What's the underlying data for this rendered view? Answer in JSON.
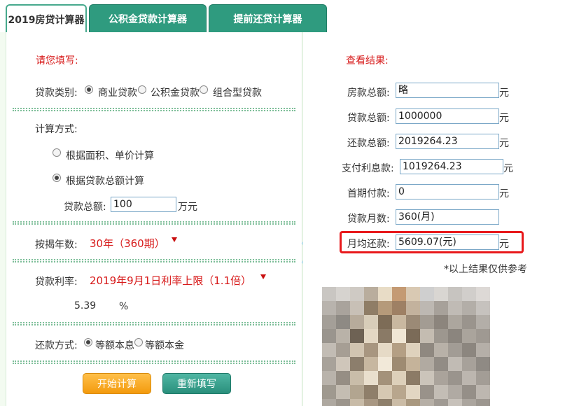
{
  "tabs": [
    {
      "label": "2019房贷计算器",
      "active": true
    },
    {
      "label": "公积金贷款计算器",
      "active": false
    },
    {
      "label": "提前还贷计算器",
      "active": false
    }
  ],
  "form": {
    "heading": "请您填写:",
    "loan_type_label": "贷款类别:",
    "loan_types": [
      "商业贷款",
      "公积金贷款",
      "组合型贷款"
    ],
    "calc_method_label": "计算方式:",
    "calc_methods": [
      "根据面积、单价计算",
      "根据贷款总额计算"
    ],
    "total_label": "贷款总额:",
    "total_value": "100",
    "total_unit": "万元",
    "years_label": "按揭年数:",
    "years_value": "30年（360期）",
    "rate_label": "贷款利率:",
    "rate_value": "2019年9月1日利率上限（1.1倍）",
    "rate_number": "5.39",
    "rate_unit": "%",
    "repay_label": "还款方式:",
    "repay_options": [
      "等额本息",
      "等额本金"
    ],
    "start_button": "开始计算",
    "reset_button": "重新填写"
  },
  "results": {
    "heading": "查看结果:",
    "rows": [
      {
        "label": "房款总额:",
        "value": "略",
        "unit": "元"
      },
      {
        "label": "贷款总额:",
        "value": "1000000",
        "unit": "元"
      },
      {
        "label": "还款总额:",
        "value": "2019264.23",
        "unit": "元"
      },
      {
        "label": "支付利息款:",
        "value": "1019264.23",
        "unit": "元"
      },
      {
        "label": "首期付款:",
        "value": "0",
        "unit": "元"
      },
      {
        "label": "贷款月数:",
        "value": "360(月)",
        "unit": ""
      },
      {
        "label": "月均还款:",
        "value": "5609.07(元)",
        "unit": "元"
      }
    ],
    "note": "*以上结果仅供参考"
  },
  "colors": {
    "accent_green": "#2f9b7f",
    "label_red": "#d71a1a",
    "highlight_red": "#e8191c"
  }
}
